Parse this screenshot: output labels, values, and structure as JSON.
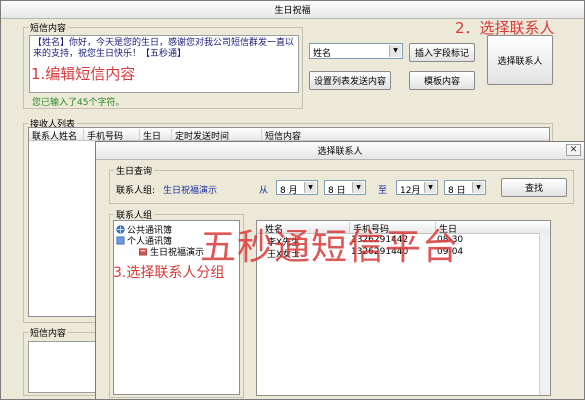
{
  "main_window": {
    "title": "生日祝福",
    "sms_content_group": "短信内容",
    "sms_text": "【姓名】你好，今天是您的生日，感谢您对我公司短信群发一直以来的支持，祝您生日快乐！【五秒通】",
    "char_count": "您已输入了45个字符。",
    "field_select": "姓名",
    "insert_field_button": "插入字段标记",
    "set_list_button": "设置列表发送内容",
    "template_button": "模板内容",
    "select_contact_button": "选择联系人",
    "receivers_group": "接收人列表",
    "receiver_columns": [
      "联系人姓名",
      "手机号码",
      "生日",
      "定时发送时间",
      "短信内容"
    ],
    "bottom_sms_label": "短信内容"
  },
  "dialog": {
    "title": "选择联系人",
    "birthday_query_group": "生日查询",
    "contact_group_label": "联系人组:",
    "contact_group_value": "生日祝福演示",
    "from_label": "从",
    "from_month": "8 月",
    "from_day": "8 日",
    "to_label": "至",
    "to_month": "12月",
    "to_day": "8 日",
    "search_button": "查找",
    "contact_tree_group": "联系人组",
    "tree_nodes": [
      "公共通讯簿",
      "个人通讯簿",
      "生日祝福演示"
    ],
    "table_columns": [
      "姓名",
      "手机号码",
      "生日"
    ],
    "rows": [
      {
        "name": "李X先生",
        "phone": "1326291442",
        "birthday": "08-30"
      },
      {
        "name": "王X女士",
        "phone": "1326291440",
        "birthday": "09-04"
      }
    ]
  },
  "annotations": {
    "step1": "1.编辑短信内容",
    "step2": "2．选择联系人",
    "step3": "3.选择联系人分组",
    "watermark": "五秒通短信平台"
  },
  "colors": {
    "annotation": "#d83a3a",
    "accent_blue": "#1a2fa0"
  }
}
